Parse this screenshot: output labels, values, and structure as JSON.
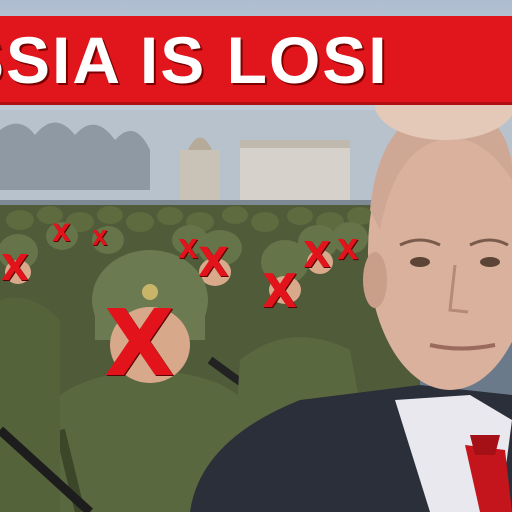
{
  "banner": {
    "text": "SSIA IS LOSI"
  },
  "marks": {
    "symbol": "X",
    "color": "#e3131b"
  },
  "colors": {
    "banner_red": "#e0161c",
    "uniform_green": "#5d6b3e",
    "tie_red": "#c4141c",
    "suit": "#2a2f3a"
  }
}
